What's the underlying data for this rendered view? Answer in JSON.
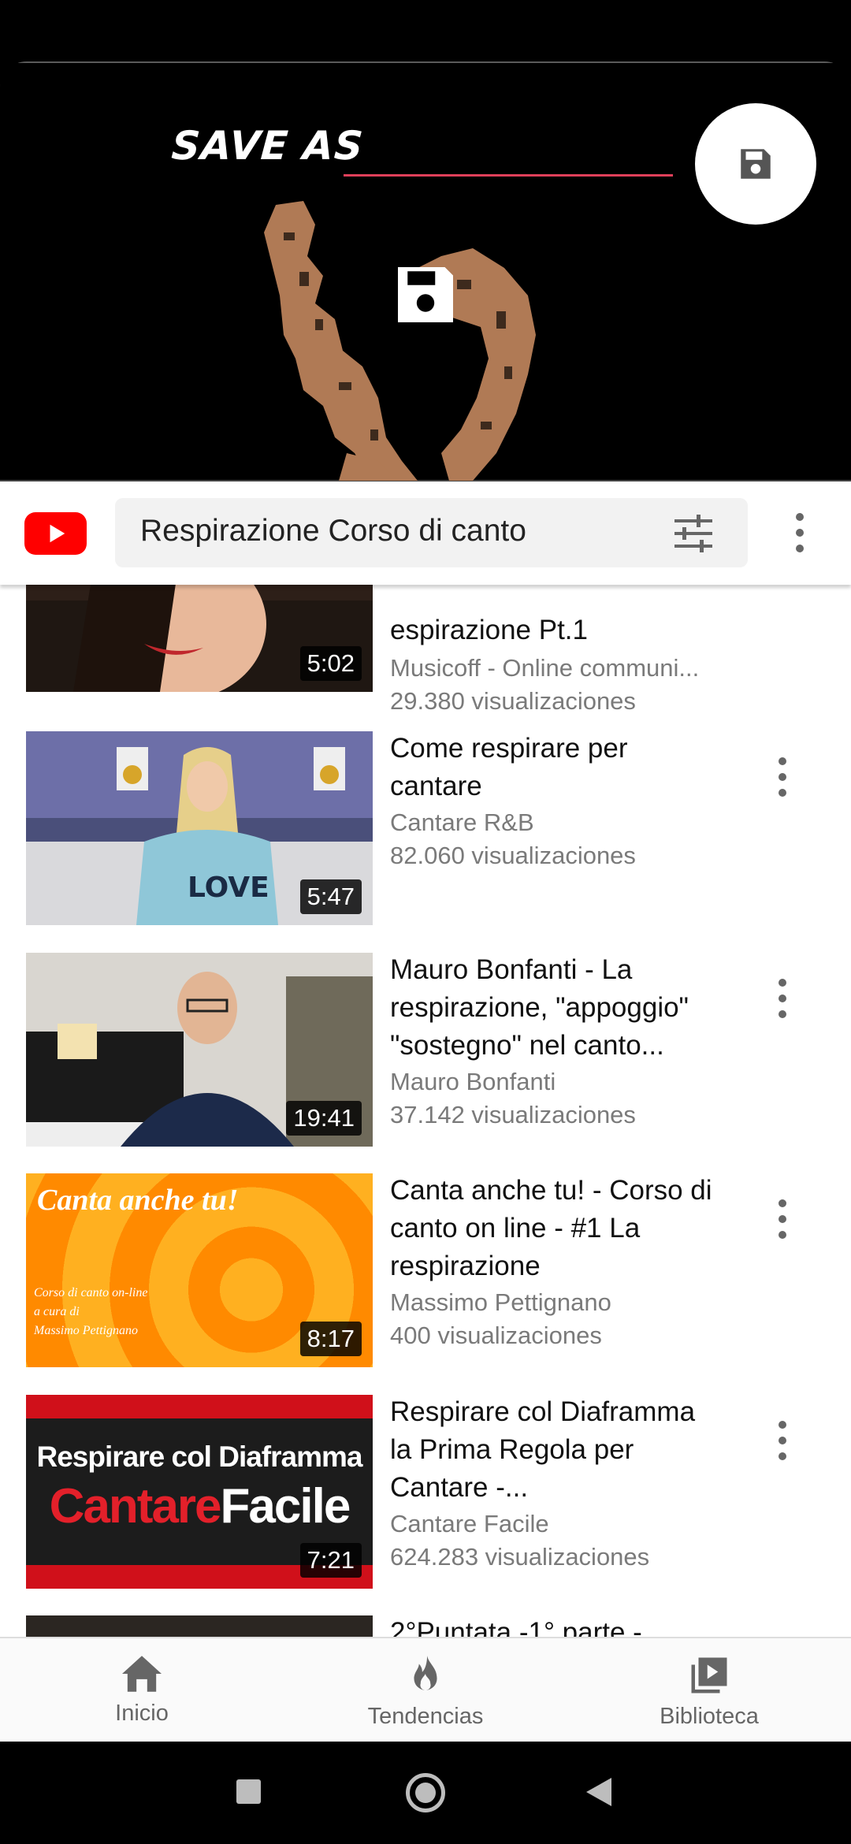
{
  "overlay": {
    "save_as_label": "SAVE AS",
    "save_as_value": "",
    "fab_icon": "floppy-disk-icon",
    "center_icon": "floppy-disk-icon"
  },
  "header": {
    "logo_icon": "youtube-play-icon",
    "search_text": "Respirazione Corso di canto",
    "filter_icon": "tune-icon",
    "more_icon": "more-vert-icon"
  },
  "results": [
    {
      "title": "espirazione Pt.1",
      "channel": "Musicoff - Online communi...",
      "views": "29.380 visualizaciones",
      "duration": "5:02"
    },
    {
      "title": "Come respirare per cantare",
      "channel": "Cantare R&B",
      "views": "82.060 visualizaciones",
      "duration": "5:47"
    },
    {
      "title": "Mauro Bonfanti - La respirazione, \"appoggio\" \"sostegno\" nel canto...",
      "channel": "Mauro Bonfanti",
      "views": "37.142 visualizaciones",
      "duration": "19:41"
    },
    {
      "title": "Canta anche tu! - Corso di canto on line - #1 La respirazione",
      "channel": "Massimo Pettignano",
      "views": "400 visualizaciones",
      "duration": "8:17",
      "thumb_title": "Canta anche tu!",
      "thumb_sub": [
        "Corso di canto on-line",
        "a cura di",
        "Massimo Pettignano"
      ]
    },
    {
      "title": "Respirare col Diaframma la Prima Regola per Cantare -...",
      "channel": "Cantare Facile",
      "views": "624.283 visualizaciones",
      "duration": "7:21",
      "thumb_line1": "Respirare col Diaframma",
      "thumb_line2a": "Cantare",
      "thumb_line2b": "Facile"
    },
    {
      "title": "2°Puntata -1° parte -"
    }
  ],
  "bottom_nav": [
    {
      "label": "Inicio",
      "icon": "home-icon"
    },
    {
      "label": "Tendencias",
      "icon": "fire-icon"
    },
    {
      "label": "Biblioteca",
      "icon": "library-icon"
    }
  ],
  "system_nav": [
    "recents-square-icon",
    "home-circle-icon",
    "back-triangle-icon"
  ]
}
